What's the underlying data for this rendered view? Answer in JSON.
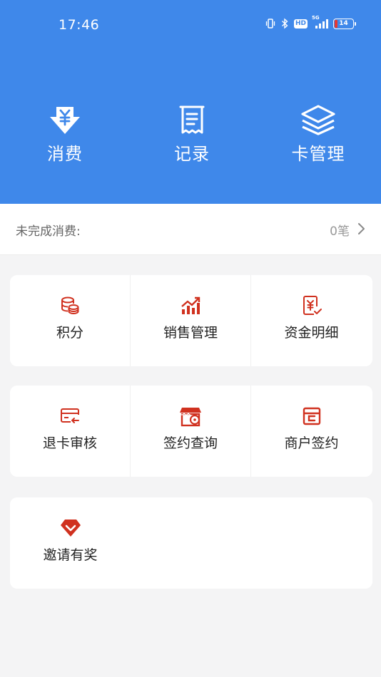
{
  "status_bar": {
    "time": "17:46",
    "hd": "HD",
    "network": "5G",
    "battery": "14"
  },
  "quick_actions": [
    {
      "label": "消费",
      "icon": "download-yen-icon"
    },
    {
      "label": "记录",
      "icon": "receipt-icon"
    },
    {
      "label": "卡管理",
      "icon": "layers-icon"
    }
  ],
  "pending": {
    "label": "未完成消费:",
    "count": "0笔"
  },
  "grid": [
    {
      "label": "积分",
      "icon": "coins-icon"
    },
    {
      "label": "销售管理",
      "icon": "sales-chart-icon"
    },
    {
      "label": "资金明细",
      "icon": "yen-document-icon"
    },
    {
      "label": "退卡审核",
      "icon": "card-return-icon"
    },
    {
      "label": "签约查询",
      "icon": "store-location-icon"
    },
    {
      "label": "商户签约",
      "icon": "merchant-sign-icon"
    },
    {
      "label": "邀请有奖",
      "icon": "diamond-icon"
    }
  ],
  "colors": {
    "primary": "#3f88ea",
    "accent": "#d0311f",
    "background": "#f4f4f5"
  }
}
